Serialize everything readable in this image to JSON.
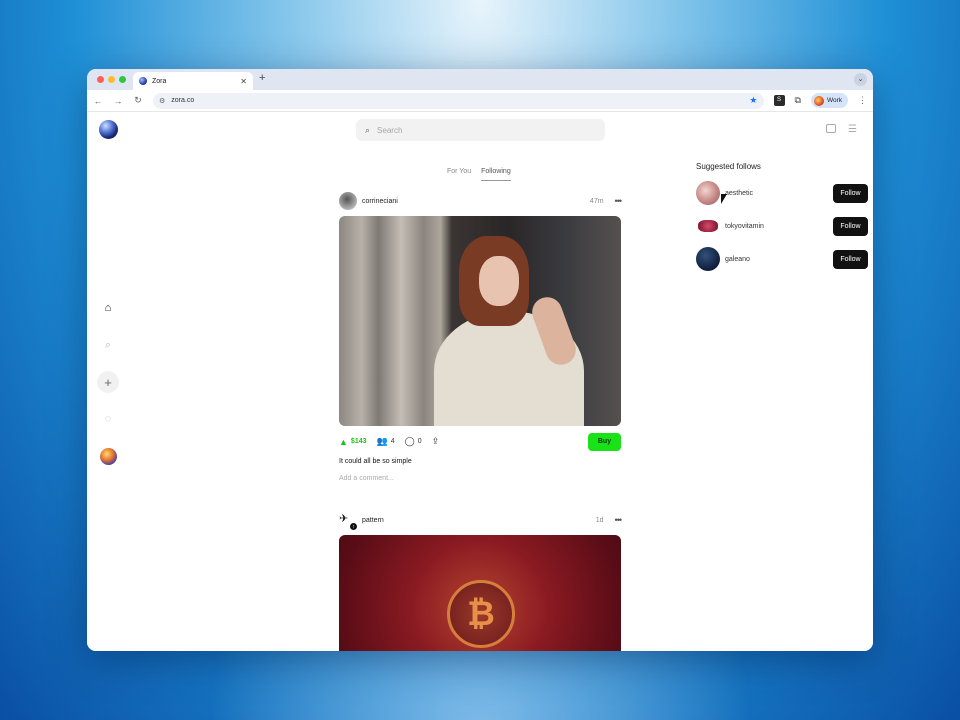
{
  "browser": {
    "tab_title": "Zora",
    "url": "zora.co",
    "profile_label": "Work",
    "ext_label": "S"
  },
  "search": {
    "placeholder": "Search"
  },
  "feed_tabs": [
    {
      "label": "For You",
      "active": false
    },
    {
      "label": "Following",
      "active": true
    }
  ],
  "posts": [
    {
      "user": "corrineciani",
      "time": "47m",
      "upvotes": "$143",
      "collectors": "4",
      "comments": "0",
      "buy_label": "Buy",
      "caption": "It could all be so simple",
      "comment_placeholder": "Add a comment..."
    },
    {
      "user": "pattern",
      "time": "1d"
    }
  ],
  "sidebar": {
    "title": "Suggested follows",
    "items": [
      {
        "name": "aesthetic",
        "button": "Follow"
      },
      {
        "name": "tokyovitamin",
        "button": "Follow"
      },
      {
        "name": "galeano",
        "button": "Follow"
      }
    ]
  },
  "colors": {
    "buy": "#19e219",
    "follow": "#111111",
    "accent_up": "#17c417"
  }
}
